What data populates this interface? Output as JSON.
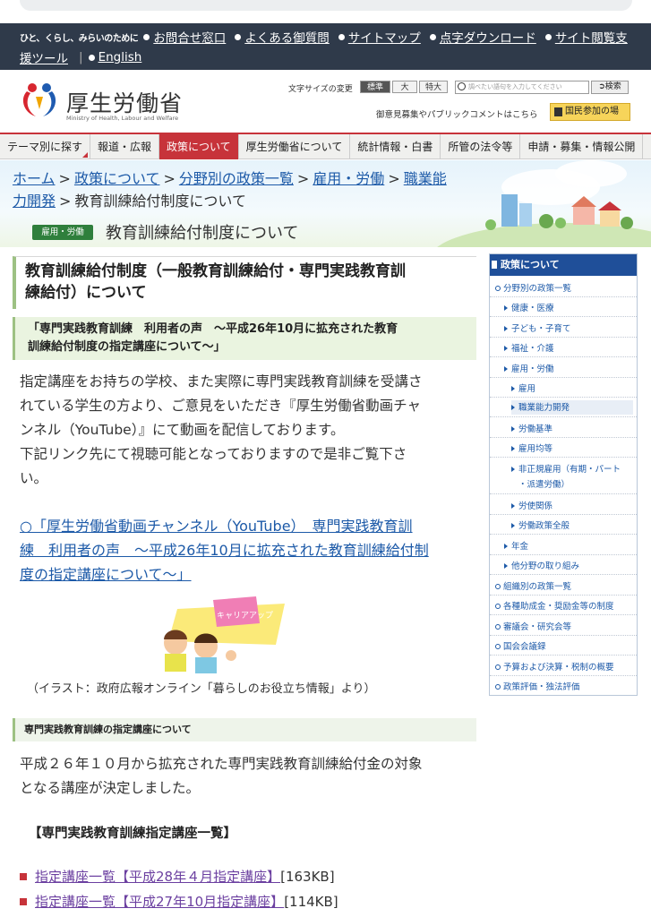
{
  "utility": {
    "tagline": "ひと、くらし、みらいのために",
    "links": [
      "お問合せ窓口",
      "よくある御質問",
      "サイトマップ",
      "点字ダウンロード",
      "サイト閲覧支",
      "援ツール",
      "English"
    ]
  },
  "header": {
    "logo_title": "厚生労働省",
    "logo_sub": "Ministry of Health, Labour and Welfare",
    "fontsize_label": "文字サイズの変更",
    "fontsize_options": [
      "標準",
      "大",
      "特大"
    ],
    "search_placeholder": "調べたい語句を入力してください",
    "search_button": "検索",
    "opinion_text": "御意見募集やパブリックコメントはこちら",
    "kokumin_button": "国民参加の場"
  },
  "gnav": [
    "テーマ別に探す",
    "報道・広報",
    "政策について",
    "厚生労働省について",
    "統計情報・白書",
    "所管の法令等",
    "申請・募集・情報公開"
  ],
  "breadcrumb": {
    "items": [
      "ホーム",
      "政策について",
      "分野別の政策一覧",
      "雇用・労働",
      "職業能",
      "力開発"
    ],
    "current": "教育訓練給付制度について"
  },
  "hero": {
    "category": "雇用・労働",
    "title": "教育訓練給付制度について"
  },
  "main": {
    "h1_line1": "教育訓練給付制度（一般教育訓練給付・専門実践教育訓",
    "h1_line2": "練給付）について",
    "sub_line1": "「専門実践教育訓練　利用者の声　～平成26年10月に拡充された教育",
    "sub_line2": "訓練給付制度の指定講座について～」",
    "p1_lines": [
      "指定講座をお持ちの学校、また実際に専門実践教育訓練を受講さ",
      "れている学生の方より、ご意見をいただき『厚生労働省動画チャ",
      "ンネル（YouTube）』にて動画を配信しております。",
      "下記リンク先にて視聴可能となっておりますので是非ご覧下さ",
      "い。"
    ],
    "video_lines": [
      "○「厚生労働省動画チャンネル（YouTube）　専門実践教育訓",
      "練　利用者の声　～平成26年10月に拡充された教育訓練給付制",
      "度の指定講座について～」"
    ],
    "illust_sign": "キャリアアップ",
    "caption": "（イラスト：政府広報オンライン「暮らしのお役立ち情報」より）",
    "section_heading": "専門実践教育訓練の指定講座について",
    "p2_lines": [
      "平成２６年１０月から拡充された専門実践教育訓練給付金の対象",
      "となる講座が決定しました。"
    ],
    "list_heading": "【専門実践教育訓練指定講座一覧】",
    "pdfs": [
      {
        "label": "指定講座一覧【平成28年４月指定講座】",
        "size": "[163KB]"
      },
      {
        "label": "指定講座一覧【平成27年10月指定講座】",
        "size": "[114KB]"
      }
    ]
  },
  "sidenav": {
    "heading": "政策について",
    "items": [
      "分野別の政策一覧",
      "健康・医療",
      "子ども・子育て",
      "福祉・介護",
      "雇用・労働",
      "雇用",
      "職業能力開発",
      "労働基準",
      "雇用均等",
      "非正規雇用（有期・パート",
      "・派遣労働）",
      "労使関係",
      "労働政策全般",
      "年金",
      "他分野の取り組み",
      "組織別の政策一覧",
      "各種助成金・奨励金等の制度",
      "審議会・研究会等",
      "国会会議録",
      "予算および決算・税制の概要",
      "政策評価・独法評価"
    ]
  },
  "colors": {
    "utility_bg": "#2f3a4a",
    "nav_active": "#c7333a",
    "side_head": "#1f4f99",
    "link": "#1d5aa8",
    "category_green": "#2f7f3c"
  }
}
